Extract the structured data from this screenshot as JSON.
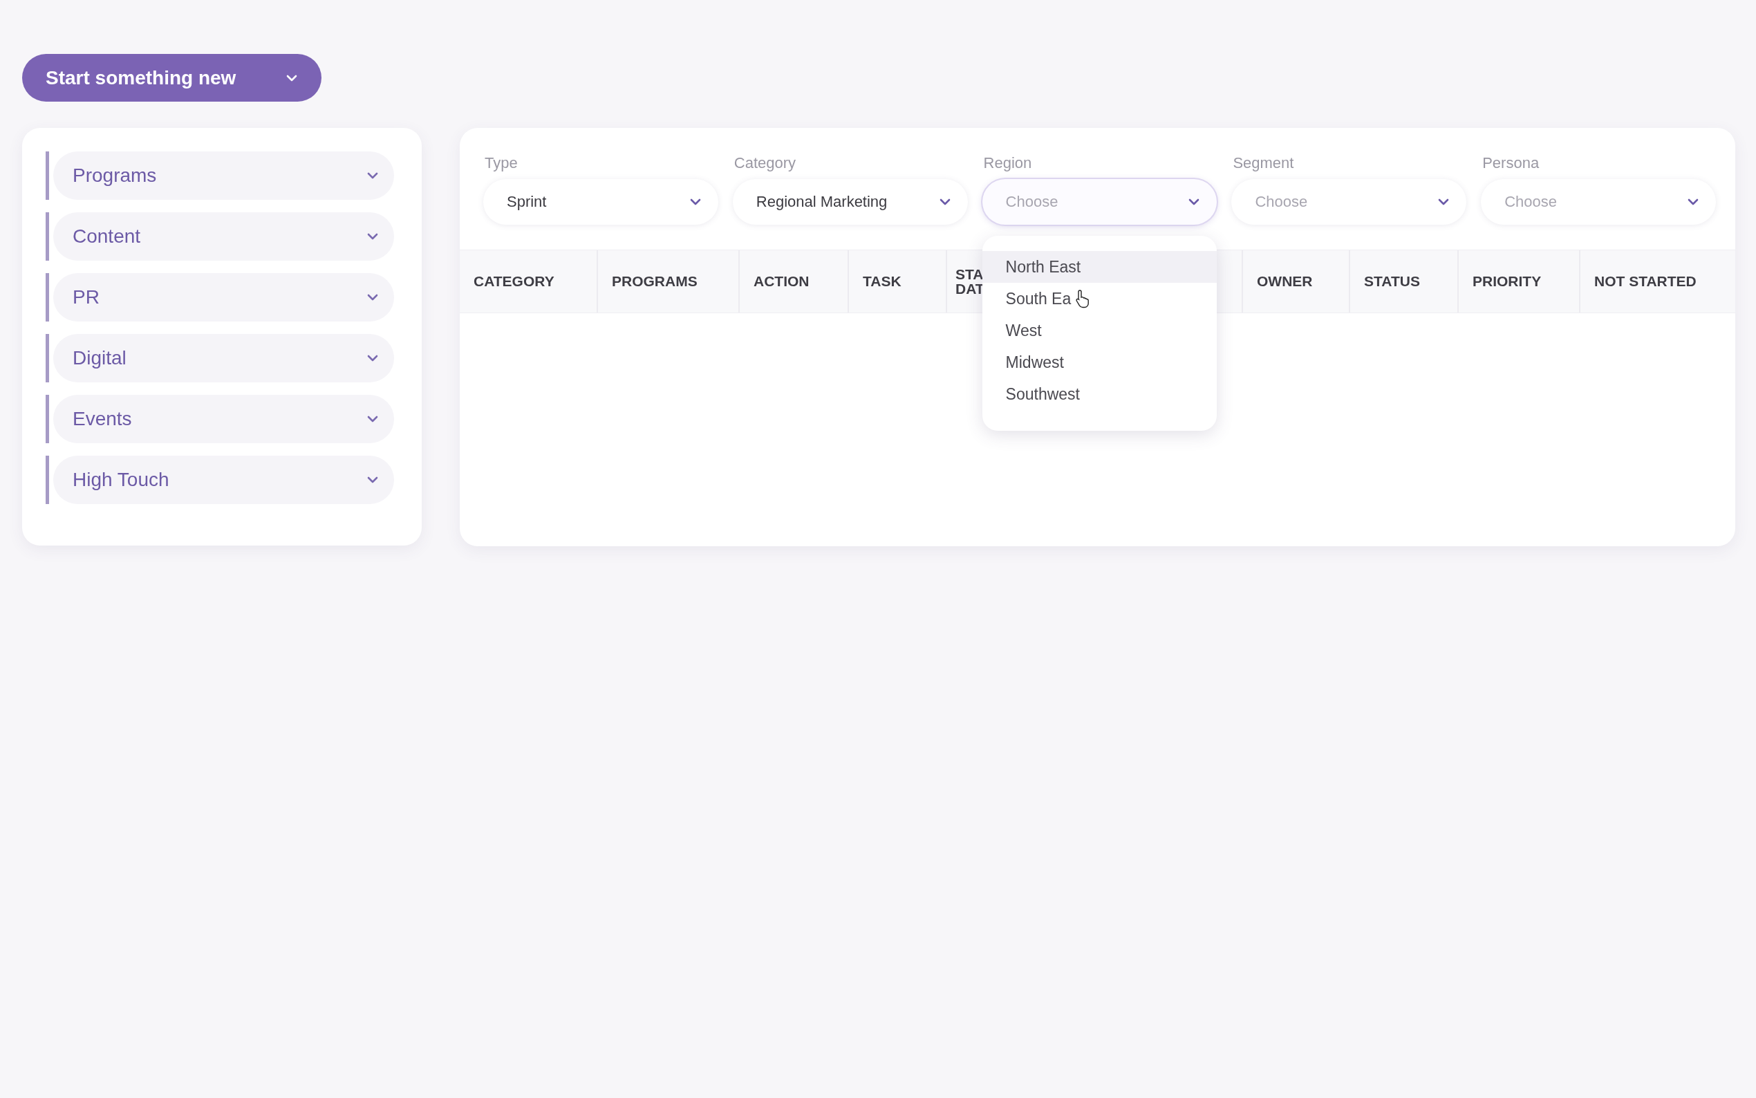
{
  "new_button": {
    "label": "Start something new"
  },
  "sidebar": {
    "items": [
      {
        "label": "Programs",
        "expanded": false
      },
      {
        "label": "Content",
        "expanded": false
      },
      {
        "label": "PR",
        "expanded": false
      },
      {
        "label": "Digital",
        "expanded": false
      },
      {
        "label": "Events",
        "expanded": false
      },
      {
        "label": "High Touch",
        "expanded": false
      }
    ]
  },
  "filters": [
    {
      "label": "Type",
      "value": "Sprint",
      "open": false
    },
    {
      "label": "Category",
      "value": "Regional Marketing",
      "open": false
    },
    {
      "label": "Region",
      "placeholder": "Choose",
      "open": true,
      "options": [
        {
          "label": "North East",
          "selected": true
        },
        {
          "label": "South Ea",
          "selected": false
        },
        {
          "label": "West",
          "selected": false
        },
        {
          "label": "Midwest",
          "selected": false
        },
        {
          "label": "Southwest",
          "selected": false
        }
      ]
    },
    {
      "label": "Segment",
      "placeholder": "Choose",
      "open": false
    },
    {
      "label": "Persona",
      "placeholder": "Choose",
      "open": false
    }
  ],
  "table": {
    "columns": [
      "CATEGORY",
      "PROGRAMS",
      "ACTION",
      "TASK",
      "STA DAT",
      "OWNER",
      "STATUS",
      "PRIORITY",
      "NOT STARTED"
    ]
  }
}
